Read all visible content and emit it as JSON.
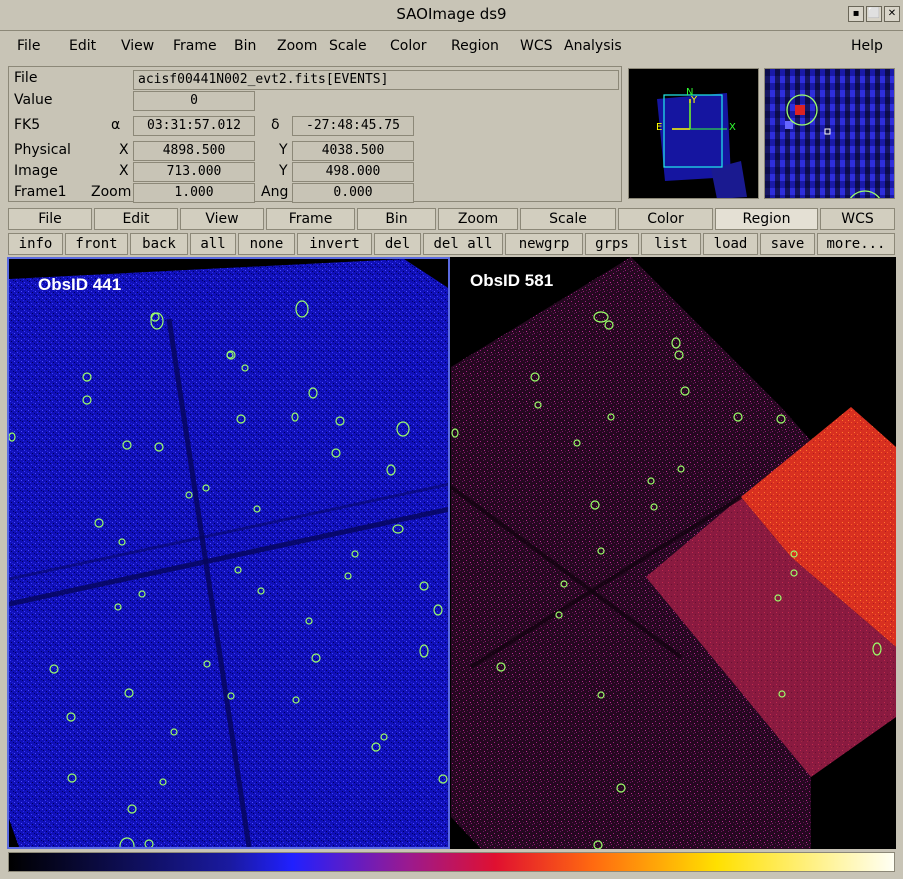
{
  "window": {
    "title": "SAOImage ds9",
    "buttons": [
      "▪",
      "⬜",
      "✕"
    ]
  },
  "menubar": {
    "left": [
      "File",
      "Edit",
      "View",
      "Frame",
      "Bin",
      "Zoom",
      "Scale",
      "Color",
      "Region",
      "WCS",
      "Analysis"
    ],
    "right": "Help"
  },
  "info": {
    "file_label": "File",
    "file_value": "acisf00441N002_evt2.fits[EVENTS]",
    "value_label": "Value",
    "value_value": "0",
    "wcs_label": "FK5",
    "alpha_symbol": "α",
    "alpha_value": "03:31:57.012",
    "delta_symbol": "δ",
    "delta_value": "-27:48:45.75",
    "physical_label": "Physical",
    "physical_x_label": "X",
    "physical_x": "4898.500",
    "physical_y_label": "Y",
    "physical_y": "4038.500",
    "image_label": "Image",
    "image_x_label": "X",
    "image_x": "713.000",
    "image_y_label": "Y",
    "image_y": "498.000",
    "frame_label": "Frame1",
    "zoom_label": "Zoom",
    "zoom_value": "1.000",
    "angle_label": "Ang",
    "angle_value": "0.000"
  },
  "panner": {
    "north": "N",
    "east": "E",
    "x_axis": "X",
    "y_axis": "Y"
  },
  "buttonbar_main": [
    "File",
    "Edit",
    "View",
    "Frame",
    "Bin",
    "Zoom",
    "Scale",
    "Color",
    "Region",
    "WCS"
  ],
  "buttonbar_main_active": "Region",
  "buttonbar_region": [
    "info",
    "front",
    "back",
    "all",
    "none",
    "invert",
    "del",
    "del all",
    "newgrp",
    "grps",
    "list",
    "load",
    "save",
    "more..."
  ],
  "frames": [
    {
      "label": "ObsID 441",
      "colormap": "blue"
    },
    {
      "label": "ObsID 581",
      "colormap": "red"
    }
  ],
  "colors": {
    "chrome": "#c8c4b6",
    "region": "#9cff6a",
    "frame_highlight": "#5a6ae0"
  }
}
